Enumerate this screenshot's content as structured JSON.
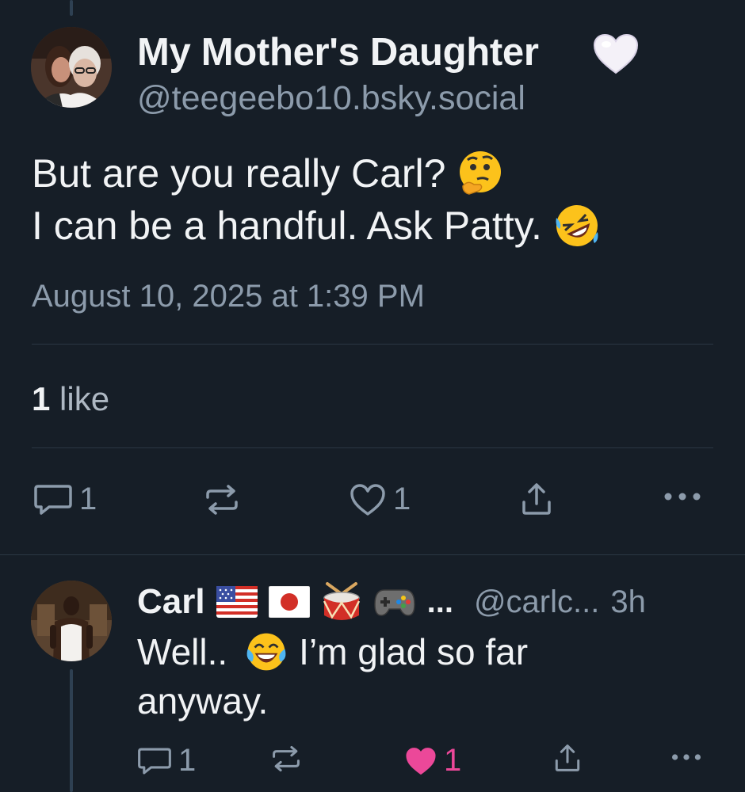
{
  "main_post": {
    "author_name": "My Mother's Daughter",
    "author_handle": "@teegeebo10.bsky.social",
    "author_name_emoji": "white-heart",
    "text_line_1": "But are you really Carl?",
    "text_line_1_emoji": "thinking-face",
    "text_line_2": "I can be a handful. Ask Patty.",
    "text_line_2_emoji": "rolling-on-floor-laughing",
    "timestamp": "August 10, 2025 at 1:39 PM",
    "likes_count": "1",
    "likes_label": "like",
    "actions": {
      "reply_count": "1",
      "repost_count": "",
      "like_count": "1"
    }
  },
  "reply": {
    "author_name": "Carl",
    "name_emojis": [
      "us-flag",
      "japan-flag",
      "drum",
      "video-game"
    ],
    "name_truncation": "...",
    "author_handle": "@carlc...",
    "time": "3h",
    "text_line_1a": "Well..",
    "text_line_1_emoji": "face-with-tears-of-joy",
    "text_line_1b": "I’m glad so far",
    "text_line_2": "anyway.",
    "actions": {
      "reply_count": "1",
      "repost_count": "",
      "like_count": "1",
      "liked": true
    }
  },
  "colors": {
    "background": "#161e27",
    "text_primary": "#f1f3f5",
    "text_secondary": "#8c9bab",
    "like_active": "#ec4899",
    "divider": "#2b3744",
    "thread_line": "#2e4052"
  }
}
